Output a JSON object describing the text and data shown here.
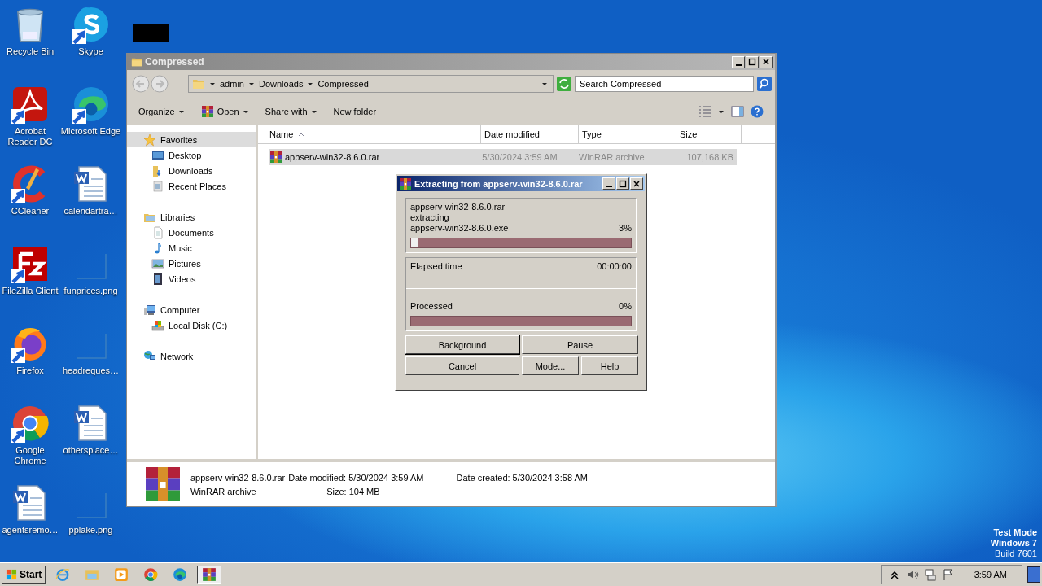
{
  "desktop": {
    "icons": [
      {
        "label": "Recycle Bin",
        "kind": "recycle",
        "shortcut": false
      },
      {
        "label": "Skype",
        "kind": "skype",
        "shortcut": true
      },
      {
        "label": "Acrobat Reader DC",
        "kind": "acrobat",
        "shortcut": true
      },
      {
        "label": "Microsoft Edge",
        "kind": "edge",
        "shortcut": true
      },
      {
        "label": "CCleaner",
        "kind": "ccleaner",
        "shortcut": true
      },
      {
        "label": "calendartra…",
        "kind": "word",
        "shortcut": false
      },
      {
        "label": "FileZilla Client",
        "kind": "filezilla",
        "shortcut": true
      },
      {
        "label": "funprices.png",
        "kind": "image",
        "shortcut": false
      },
      {
        "label": "Firefox",
        "kind": "firefox",
        "shortcut": true
      },
      {
        "label": "headreques…",
        "kind": "image",
        "shortcut": false
      },
      {
        "label": "Google Chrome",
        "kind": "chrome",
        "shortcut": true
      },
      {
        "label": "othersplace…",
        "kind": "word",
        "shortcut": false
      },
      {
        "label": "agentsremo…",
        "kind": "word",
        "shortcut": false
      },
      {
        "label": "pplake.png",
        "kind": "image",
        "shortcut": false
      }
    ]
  },
  "explorer": {
    "title": "Compressed",
    "breadcrumb": [
      "admin",
      "Downloads",
      "Compressed"
    ],
    "search": {
      "placeholder": "Search Compressed"
    },
    "toolbar": [
      {
        "label": "Organize",
        "kind": "menu"
      },
      {
        "label": "Open",
        "kind": "winrar-menu"
      },
      {
        "label": "Share with",
        "kind": "menu"
      },
      {
        "label": "New folder",
        "kind": "plain"
      }
    ],
    "sidebar": {
      "items": [
        {
          "label": "Favorites",
          "kind": "star",
          "selected": true,
          "children": [
            {
              "label": "Desktop",
              "kind": "desktop",
              "selected": false
            },
            {
              "label": "Downloads",
              "kind": "downloads",
              "selected": false
            },
            {
              "label": "Recent Places",
              "kind": "recent",
              "selected": false
            }
          ]
        },
        {
          "label": "Libraries",
          "kind": "library",
          "selected": false,
          "children": [
            {
              "label": "Documents",
              "kind": "doc",
              "selected": false
            },
            {
              "label": "Music",
              "kind": "music",
              "selected": false
            },
            {
              "label": "Pictures",
              "kind": "pictures",
              "selected": false
            },
            {
              "label": "Videos",
              "kind": "videos",
              "selected": false
            }
          ]
        },
        {
          "label": "Computer",
          "kind": "computer",
          "selected": false,
          "children": [
            {
              "label": "Local Disk (C:)",
              "kind": "disk",
              "selected": false
            }
          ]
        },
        {
          "label": "Network",
          "kind": "network",
          "selected": false
        }
      ]
    },
    "table": {
      "columns": [
        "Name",
        "Date modified",
        "Type",
        "Size"
      ],
      "rows": [
        {
          "cells": [
            "appserv-win32-8.6.0.rar",
            "5/30/2024 3:59 AM",
            "WinRAR archive",
            "107,168 KB"
          ],
          "selected": true
        }
      ]
    },
    "details": {
      "name": "appserv-win32-8.6.0.rar",
      "type": "WinRAR archive",
      "fields": [
        {
          "label": "Date modified:",
          "value": "5/30/2024 3:59 AM"
        },
        {
          "label": "Size:",
          "value": "104 MB"
        },
        {
          "label": "Date created:",
          "value": "5/30/2024 3:58 AM"
        }
      ]
    }
  },
  "dialog": {
    "title": "Extracting from appserv-win32-8.6.0.rar",
    "archive": "appserv-win32-8.6.0.rar",
    "action": "extracting",
    "file": "appserv-win32-8.6.0.exe",
    "file_percent": "3%",
    "file_progress": {
      "level": 0.03
    },
    "elapsed_label": "Elapsed time",
    "elapsed": "00:00:00",
    "processed_label": "Processed",
    "processed_percent": "0%",
    "processed_progress": {
      "level": 0
    },
    "buttons": [
      {
        "label": "Background",
        "default": true
      },
      {
        "label": "Pause",
        "default": false
      },
      {
        "label": "Cancel",
        "default": false
      },
      {
        "label": "Mode...",
        "default": false
      },
      {
        "label": "Help",
        "default": false
      }
    ]
  },
  "os_notice": [
    "Test Mode",
    "Windows 7",
    "Build 7601"
  ],
  "taskbar": {
    "start": "Start",
    "apps": [
      {
        "kind": "ie",
        "selected": false
      },
      {
        "kind": "explorer",
        "selected": false
      },
      {
        "kind": "media",
        "selected": false
      },
      {
        "kind": "chrome",
        "selected": false
      },
      {
        "kind": "edge",
        "selected": false
      },
      {
        "kind": "winrar",
        "selected": true
      }
    ],
    "time": "3:59 AM"
  }
}
